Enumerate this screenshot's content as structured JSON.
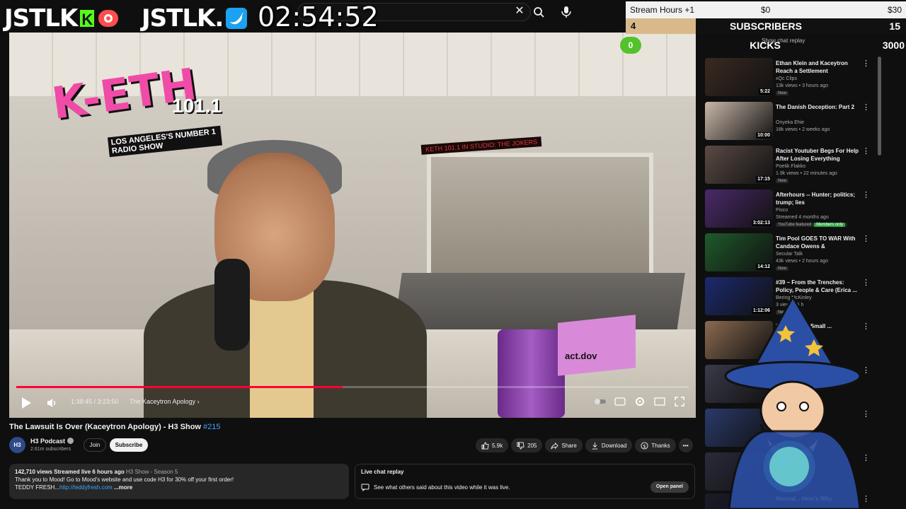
{
  "overlay": {
    "logo_left": "JSTLK",
    "kick_letter": "K",
    "logo_right": "JSTLK.",
    "clock": "02:54:52",
    "goals": {
      "stream_hours_label": "Stream Hours +1",
      "stream_hours_current": "$0",
      "stream_hours_target": "$30",
      "subscribers_label": "SUBSCRIBERS",
      "subscribers_current": "4",
      "subscribers_target": "15",
      "subscribers_progress": 0.25,
      "kicks_label": "KICKS",
      "kicks_current": "0",
      "kicks_target": "3000",
      "chat_replay_hint": "Show chat replay"
    }
  },
  "video": {
    "scene": {
      "station_freq": "101.1",
      "station_tagline": "LOS ANGELES'S NUMBER 1 RADIO SHOW",
      "sign_text": "KETH 101.1 IN STUDIO: THE JOKERS",
      "box_label": "act.dov"
    },
    "player": {
      "time": "1:38:45 / 3:23:50",
      "chapter": "The Kaceytron Apology",
      "progress": 0.485,
      "buffered": 0.5
    },
    "title": "The Lawsuit Is Over (Kaceytron Apology) - H3 Show",
    "title_tag": "#215",
    "channel": {
      "avatar_text": "H3",
      "name": "H3 Podcast",
      "subs": "2.61m subscribers",
      "join": "Join",
      "subscribe": "Subscribe"
    },
    "actions": {
      "likes": "5.9k",
      "dislikes": "205",
      "share": "Share",
      "download": "Download",
      "thanks": "Thanks"
    },
    "description": {
      "views_line": "142,710 views  Streamed live 6 hours ago",
      "playlist": "H3 Show - Season 5",
      "line2": "Thank you to Mood! Go to Mood's website and use code H3 for 30% off your first order!",
      "line3_prefix": "TEDDY FRESH...",
      "link": "http://teddyfresh.com",
      "more": "...more"
    },
    "chat": {
      "title": "Live chat replay",
      "body": "See what others said about this video while it was live.",
      "open": "Open panel"
    }
  },
  "recommendations": [
    {
      "title": "Ethan Klein and Kaceytron Reach a Settlement",
      "channel": "xQc Clips",
      "views": "13k views • 3 hours ago",
      "badge": "New",
      "duration": "5:22",
      "color": "#3a2a22"
    },
    {
      "title": "The Danish Deception: Part 2",
      "channel": "Onyeka Ehie",
      "views": "18k views • 2 weeks ago",
      "badge": "",
      "duration": "10:00",
      "color": "#c9b7a8"
    },
    {
      "title": "Racist Youtuber Begs For Help After Losing Everything",
      "channel": "Poetik Flakko",
      "views": "1.9k views • 22 minutes ago",
      "badge": "New",
      "duration": "17:15",
      "color": "#5b4a44"
    },
    {
      "title": "Afterhours -- Hunter; politics; trump; lies",
      "channel": "Pisco",
      "views": "Streamed 4 months ago",
      "badge": "YouTube featured",
      "members": "Members only",
      "duration": "3:02:13",
      "color": "#4a2a6a"
    },
    {
      "title": "Tim Pool GOES TO WAR With Candace Owens & Accidentall...",
      "channel": "Secular Talk",
      "views": "43k views • 2 hours ago",
      "badge": "New",
      "duration": "14:12",
      "color": "#1f5a2c"
    },
    {
      "title": "#39 – From the Trenches: Policy, People & Care (Erica ...",
      "channel": "Bering McKinley",
      "views": "3 views • 6 h",
      "badge": "New",
      "duration": "1:12:06",
      "color": "#1c2a6e"
    },
    {
      "title": "How ... on ... Small ...",
      "channel": "",
      "views": "",
      "badge": "",
      "duration": "",
      "color": "#8a6a50"
    },
    {
      "title": "",
      "channel": "",
      "views": "",
      "badge": "",
      "duration": "",
      "color": "#3a3a4a"
    },
    {
      "title": "... ng ... -Tok)",
      "channel": "",
      "views": "",
      "badge": "",
      "duration": "",
      "color": "#2a3a6a"
    },
    {
      "title": "",
      "channel": "",
      "views": "",
      "badge": "",
      "duration": "",
      "color": "#2a2a3a"
    },
    {
      "title": "Normal... Here's Why",
      "channel": "",
      "views": "",
      "badge": "",
      "duration": "",
      "color": "#1a1a2a"
    }
  ],
  "colors": {
    "accent_red": "#ff0033",
    "link_blue": "#3ea6ff",
    "kick_green": "#53fc18"
  }
}
